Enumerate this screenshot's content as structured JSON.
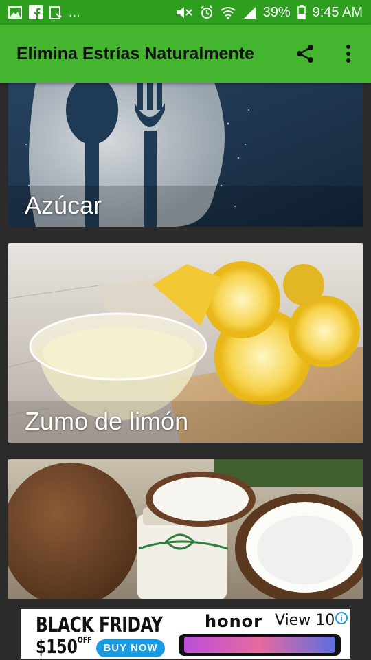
{
  "status_bar": {
    "left_icons": [
      "image-icon",
      "facebook-icon",
      "clipboard-icon"
    ],
    "overflow": "...",
    "right_icons": [
      "mute-icon",
      "alarm-icon",
      "wifi-icon",
      "signal-icon"
    ],
    "battery": "39%",
    "time": "9:45 AM"
  },
  "app_bar": {
    "title": "Elimina Estrías Naturalmente",
    "actions": [
      "share-icon",
      "more-vert-icon"
    ],
    "color": "#43b52f"
  },
  "cards": [
    {
      "label": "Azúcar"
    },
    {
      "label": "Zumo de limón"
    },
    {
      "label": ""
    }
  ],
  "ad": {
    "headline": "BLACK FRIDAY",
    "price": "$150",
    "price_suffix": "OFF",
    "cta": "BUY NOW",
    "brand": "honor",
    "model": "View 10",
    "info_icon": "info-icon"
  }
}
